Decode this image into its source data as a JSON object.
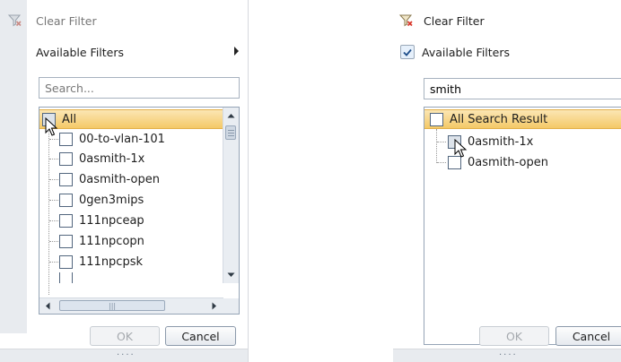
{
  "left_panel": {
    "clear_filter": "Clear Filter",
    "available_filters": "Available Filters",
    "search": {
      "value": "",
      "placeholder": "Search..."
    },
    "tree_items": [
      "All",
      "00-to-vlan-101",
      "0asmith-1x",
      "0asmith-open",
      "0gen3mips",
      "111npceap",
      "111npcopn",
      "111npcpsk"
    ],
    "buttons": {
      "ok": "OK",
      "cancel": "Cancel"
    }
  },
  "right_panel": {
    "clear_filter": "Clear Filter",
    "available_filters": "Available Filters",
    "available_filters_checked": true,
    "search": {
      "value": "smith",
      "placeholder": ""
    },
    "tree_items": [
      "All Search Result",
      "0asmith-1x",
      "0asmith-open"
    ],
    "buttons": {
      "ok": "OK",
      "cancel": "Cancel"
    }
  },
  "colors": {
    "selected_row": "#f4c967",
    "gutter": "#e8ebef",
    "clear_icon_red": "#d8372a"
  }
}
